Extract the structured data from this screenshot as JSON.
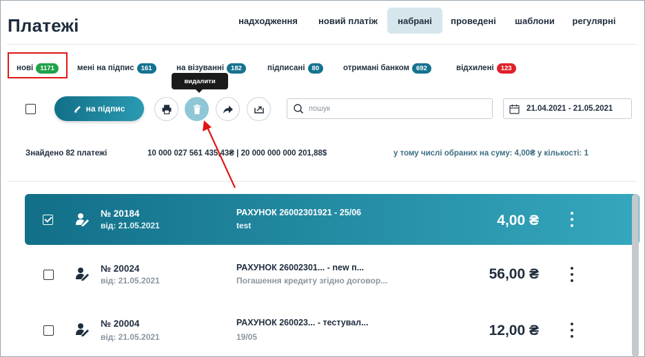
{
  "title": "Платежі",
  "topnav": [
    "надходження",
    "новий платіж",
    "набрані",
    "проведені",
    "шаблони",
    "регулярні"
  ],
  "topnav_active": "набрані",
  "status_tabs": [
    {
      "label": "нові",
      "count": "1171",
      "color": "green"
    },
    {
      "label": "мені на підпис",
      "count": "161",
      "color": "teal"
    },
    {
      "label": "на візуванні",
      "count": "182",
      "color": "teal"
    },
    {
      "label": "підписані",
      "count": "80",
      "color": "teal"
    },
    {
      "label": "отримані банком",
      "count": "692",
      "color": "teal"
    },
    {
      "label": "відхилені",
      "count": "123",
      "color": "red"
    }
  ],
  "toolbar": {
    "sign_label": "на підпис",
    "tooltip": "видалити",
    "search_placeholder": "пошук",
    "date_range": "21.04.2021 - 21.05.2021"
  },
  "summary": {
    "found": "Знайдено 82 платежі",
    "totals": "10 000 027 561 435,43₴ | 20 000 000 000 201,88$",
    "selected": "у тому числі обраних на суму: 4,00₴ у кількості: 1"
  },
  "payments": [
    {
      "number": "№ 20184",
      "date": "від: 21.05.2021",
      "account": "РАХУНОК 26002301921   -   25/06",
      "description": "test",
      "amount": "4,00 ₴",
      "selected": true
    },
    {
      "number": "№ 20024",
      "date": "від: 21.05.2021",
      "account": "РАХУНОК 26002301...   -   new п...",
      "description": "Погашення кредиту згідно договор...",
      "amount": "56,00 ₴",
      "selected": false
    },
    {
      "number": "№ 20004",
      "date": "від: 21.05.2021",
      "account": "РАХУНОК 260023...   -   тестувал...",
      "description": "19/05",
      "amount": "12,00 ₴",
      "selected": false
    }
  ],
  "colors": {
    "accent": "#1a8aa5",
    "badge_green": "#1fa24a",
    "badge_red": "#e0202a",
    "annotation_red": "#e01515"
  },
  "icons": [
    "pen-icon",
    "print-icon",
    "trash-icon",
    "forward-icon",
    "export-icon",
    "search-icon",
    "calendar-icon",
    "signer-icon",
    "more-icon"
  ]
}
